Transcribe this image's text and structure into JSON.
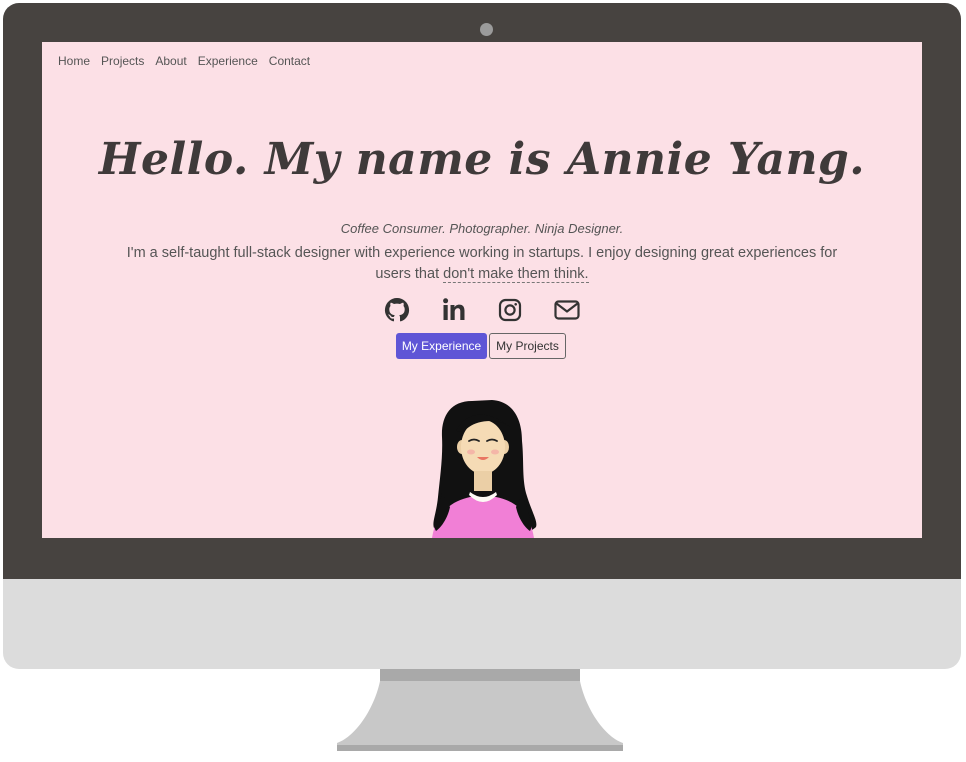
{
  "nav": {
    "items": [
      "Home",
      "Projects",
      "About",
      "Experience",
      "Contact"
    ]
  },
  "hero": {
    "title": "Hello. My name is Annie Yang.",
    "subtitle": "Coffee Consumer. Photographer. Ninja Designer.",
    "bio_text": "I'm a self-taught full-stack designer with experience working in startups. I enjoy designing great experiences for users that ",
    "bio_link": "don't make them think."
  },
  "socials": [
    "github-icon",
    "linkedin-icon",
    "instagram-icon",
    "mail-icon"
  ],
  "buttons": {
    "primary_label": "My Experience",
    "secondary_label": "My Projects"
  },
  "colors": {
    "screen_bg": "#fce0e6",
    "accent": "#5f55d6",
    "bezel": "#474340",
    "shirt": "#f17fd6"
  }
}
